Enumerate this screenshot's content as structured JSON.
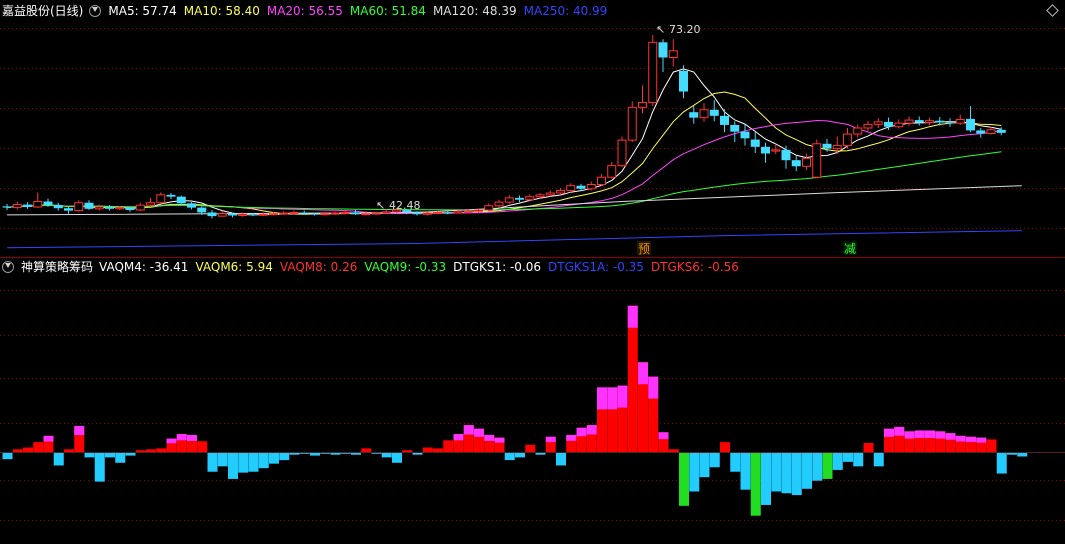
{
  "header": {
    "title": "嘉益股份(日线)",
    "ma": [
      {
        "label": "MA5: 57.74",
        "color": "#ffffff"
      },
      {
        "label": "MA10: 58.40",
        "color": "#ffff55"
      },
      {
        "label": "MA20: 56.55",
        "color": "#ff44ff"
      },
      {
        "label": "MA60: 51.84",
        "color": "#33ff33"
      },
      {
        "label": "MA120: 48.39",
        "color": "#dddddd"
      },
      {
        "label": "MA250: 40.99",
        "color": "#3344ff"
      }
    ]
  },
  "indicator_header": {
    "title": "神算策略筹码",
    "items": [
      {
        "label": "VAQM4: -36.41",
        "color": "#ffffff"
      },
      {
        "label": "VAQM6: 5.94",
        "color": "#ffff55"
      },
      {
        "label": "VAQM8: 0.26",
        "color": "#ff3333"
      },
      {
        "label": "VAQM9: -0.33",
        "color": "#33ff33"
      },
      {
        "label": "DTGKS1: -0.06",
        "color": "#ffffff"
      },
      {
        "label": "DTGKS1A: -0.35",
        "color": "#3344ff"
      },
      {
        "label": "DTGKS6: -0.56",
        "color": "#ff3333"
      }
    ]
  },
  "annotations": {
    "high_label": "73.20",
    "low_label": "42.48",
    "signal_1": "预",
    "signal_2": "减"
  },
  "colors": {
    "up": "#ff3333",
    "down": "#44ddff",
    "ma5": "#ffffff",
    "ma10": "#ffff55",
    "ma20": "#ff44ff",
    "ma60": "#33ff33",
    "ma120": "#dddddd",
    "ma250": "#3344ff",
    "grid": "#8b0000",
    "bar_red": "#ff0000",
    "bar_magenta": "#ff33ff",
    "bar_cyan": "#22ccff",
    "bar_green": "#22dd22"
  },
  "chart_data": [
    {
      "type": "candlestick",
      "ylim": [
        37,
        76
      ],
      "candles": [
        [
          45.0,
          44.8,
          45.4,
          44.4
        ],
        [
          44.8,
          45.3,
          45.8,
          44.5
        ],
        [
          45.3,
          44.9,
          45.7,
          44.6
        ],
        [
          44.9,
          45.8,
          47.3,
          44.7
        ],
        [
          45.8,
          45.2,
          46.3,
          44.9
        ],
        [
          45.2,
          44.7,
          45.6,
          44.3
        ],
        [
          44.7,
          44.3,
          45.0,
          43.8
        ],
        [
          44.3,
          45.6,
          46.0,
          44.1
        ],
        [
          45.6,
          44.6,
          46.0,
          44.4
        ],
        [
          44.6,
          44.9,
          45.3,
          44.3
        ],
        [
          44.9,
          44.6,
          45.2,
          44.3
        ],
        [
          44.6,
          44.8,
          45.1,
          44.4
        ],
        [
          44.8,
          44.4,
          45.0,
          44.1
        ],
        [
          44.4,
          45.2,
          45.6,
          44.2
        ],
        [
          45.2,
          45.6,
          46.4,
          44.9
        ],
        [
          45.6,
          46.9,
          47.3,
          45.4
        ],
        [
          46.9,
          46.6,
          47.2,
          46.2
        ],
        [
          46.6,
          45.5,
          46.8,
          45.2
        ],
        [
          45.5,
          44.8,
          45.7,
          44.5
        ],
        [
          44.8,
          44.0,
          45.0,
          43.6
        ],
        [
          44.0,
          43.4,
          44.4,
          43.0
        ],
        [
          43.4,
          43.8,
          44.2,
          43.3
        ],
        [
          43.8,
          43.5,
          44.0,
          43.2
        ],
        [
          43.5,
          43.7,
          44.0,
          43.3
        ],
        [
          43.7,
          43.6,
          43.9,
          43.4
        ],
        [
          43.6,
          43.7,
          44.0,
          43.4
        ],
        [
          43.7,
          43.8,
          44.1,
          43.5
        ],
        [
          43.8,
          43.9,
          44.2,
          43.6
        ],
        [
          43.9,
          44.0,
          44.3,
          43.7
        ],
        [
          44.0,
          43.8,
          44.3,
          43.6
        ],
        [
          43.8,
          43.7,
          44.0,
          43.5
        ],
        [
          43.7,
          43.8,
          44.1,
          43.5
        ],
        [
          43.8,
          43.9,
          44.2,
          43.6
        ],
        [
          43.9,
          44.0,
          44.3,
          43.7
        ],
        [
          44.0,
          43.7,
          44.4,
          43.6
        ],
        [
          43.7,
          43.8,
          44.0,
          43.5
        ],
        [
          43.8,
          43.9,
          44.1,
          43.6
        ],
        [
          43.9,
          44.1,
          44.5,
          43.8
        ],
        [
          44.1,
          44.4,
          44.7,
          43.9
        ],
        [
          44.4,
          44.0,
          44.6,
          43.7
        ],
        [
          44.0,
          43.7,
          44.2,
          43.5
        ],
        [
          43.7,
          43.9,
          44.1,
          43.5
        ],
        [
          43.9,
          44.0,
          44.2,
          43.7
        ],
        [
          44.0,
          43.9,
          44.2,
          43.7
        ],
        [
          43.9,
          44.1,
          44.4,
          43.8
        ],
        [
          44.1,
          44.2,
          44.5,
          43.9
        ],
        [
          44.2,
          44.4,
          44.6,
          44.0
        ],
        [
          44.4,
          45.1,
          45.5,
          44.2
        ],
        [
          45.1,
          45.7,
          46.1,
          44.8
        ],
        [
          45.7,
          46.4,
          46.9,
          45.4
        ],
        [
          46.4,
          46.1,
          46.8,
          45.7
        ],
        [
          46.1,
          46.6,
          47.0,
          45.8
        ],
        [
          46.6,
          46.9,
          47.2,
          46.3
        ],
        [
          46.9,
          47.2,
          47.6,
          46.6
        ],
        [
          47.2,
          47.6,
          48.0,
          46.9
        ],
        [
          47.6,
          48.4,
          48.8,
          47.3
        ],
        [
          48.4,
          47.9,
          48.7,
          47.5
        ],
        [
          47.9,
          48.6,
          49.1,
          47.6
        ],
        [
          48.6,
          49.8,
          50.3,
          48.4
        ],
        [
          49.8,
          51.7,
          52.3,
          49.6
        ],
        [
          51.7,
          55.9,
          56.5,
          51.5
        ],
        [
          55.9,
          61.3,
          62.3,
          55.6
        ],
        [
          61.3,
          62.1,
          64.9,
          60.3
        ],
        [
          62.1,
          72.0,
          73.2,
          61.5
        ],
        [
          72.0,
          69.5,
          72.5,
          67.1
        ],
        [
          69.5,
          70.6,
          72.5,
          68.0
        ],
        [
          67.3,
          63.9,
          68.2,
          62.8
        ],
        [
          60.5,
          59.6,
          61.5,
          58.6
        ],
        [
          59.6,
          60.9,
          62.0,
          58.9
        ],
        [
          60.9,
          59.9,
          62.5,
          59.0
        ],
        [
          59.9,
          58.4,
          61.0,
          57.2
        ],
        [
          58.4,
          57.3,
          59.0,
          55.6
        ],
        [
          57.3,
          56.2,
          58.5,
          55.0
        ],
        [
          56.0,
          54.8,
          57.2,
          53.8
        ],
        [
          54.8,
          53.7,
          55.5,
          52.2
        ],
        [
          54.1,
          54.3,
          55.3,
          53.6
        ],
        [
          54.3,
          52.6,
          55.0,
          51.2
        ],
        [
          52.6,
          51.6,
          53.3,
          50.8
        ],
        [
          51.6,
          52.9,
          53.7,
          51.0
        ],
        [
          49.8,
          55.3,
          56.0,
          49.6
        ],
        [
          55.3,
          54.5,
          56.1,
          54.0
        ],
        [
          54.5,
          55.0,
          56.5,
          53.6
        ],
        [
          55.0,
          56.9,
          57.9,
          54.5
        ],
        [
          56.9,
          57.9,
          58.5,
          56.3
        ],
        [
          57.9,
          58.5,
          59.1,
          57.4
        ],
        [
          58.5,
          58.9,
          59.5,
          57.9
        ],
        [
          58.9,
          58.1,
          59.6,
          57.6
        ],
        [
          58.1,
          58.7,
          59.3,
          57.8
        ],
        [
          58.7,
          59.2,
          59.8,
          58.2
        ],
        [
          59.2,
          58.8,
          59.8,
          58.3
        ],
        [
          58.8,
          59.1,
          59.6,
          58.4
        ],
        [
          59.1,
          58.8,
          59.7,
          58.3
        ],
        [
          58.8,
          58.7,
          59.5,
          58.1
        ],
        [
          58.7,
          59.3,
          60.1,
          58.4
        ],
        [
          59.4,
          57.5,
          61.5,
          57.2
        ],
        [
          57.5,
          57.0,
          57.9,
          56.3
        ],
        [
          57.0,
          57.6,
          58.1,
          56.8
        ],
        [
          57.6,
          57.1,
          58.0,
          56.7
        ]
      ]
    },
    {
      "type": "bar",
      "ylim": [
        -10.0,
        19.5
      ],
      "values": [
        -0.8,
        0.3,
        0.5,
        1.1,
        1.8,
        -1.5,
        0.3,
        2.9,
        -0.6,
        -3.3,
        -0.6,
        -1.2,
        -0.4,
        0.2,
        0.3,
        0.4,
        1.5,
        2.0,
        1.9,
        1.2,
        -2.2,
        -1.6,
        -3.0,
        -2.3,
        -2.2,
        -1.8,
        -1.3,
        -0.9,
        -0.3,
        -0.2,
        -0.4,
        -0.2,
        -0.3,
        -0.2,
        -0.3,
        0.4,
        -0.2,
        -0.6,
        -1.2,
        0.2,
        -0.3,
        0.5,
        0.4,
        1.3,
        2.0,
        3.0,
        2.6,
        1.9,
        1.6,
        -0.9,
        -0.6,
        0.8,
        -0.3,
        1.7,
        -1.5,
        1.9,
        2.7,
        3.0,
        7.2,
        7.2,
        7.4,
        16.3,
        10.0,
        8.4,
        2.2,
        0.3,
        -6.0,
        -4.4,
        -2.8,
        -1.7,
        1.1,
        -2.2,
        -4.2,
        -7.1,
        -5.9,
        -4.4,
        -4.6,
        -4.8,
        -4.1,
        -3.2,
        -3.0,
        -2.0,
        -1.1,
        -1.6,
        1.0,
        -1.6,
        2.6,
        2.8,
        2.3,
        2.4,
        2.4,
        2.3,
        2.1,
        1.8,
        1.7,
        1.6,
        1.4,
        -2.4,
        -0.3,
        -0.5
      ]
    }
  ]
}
